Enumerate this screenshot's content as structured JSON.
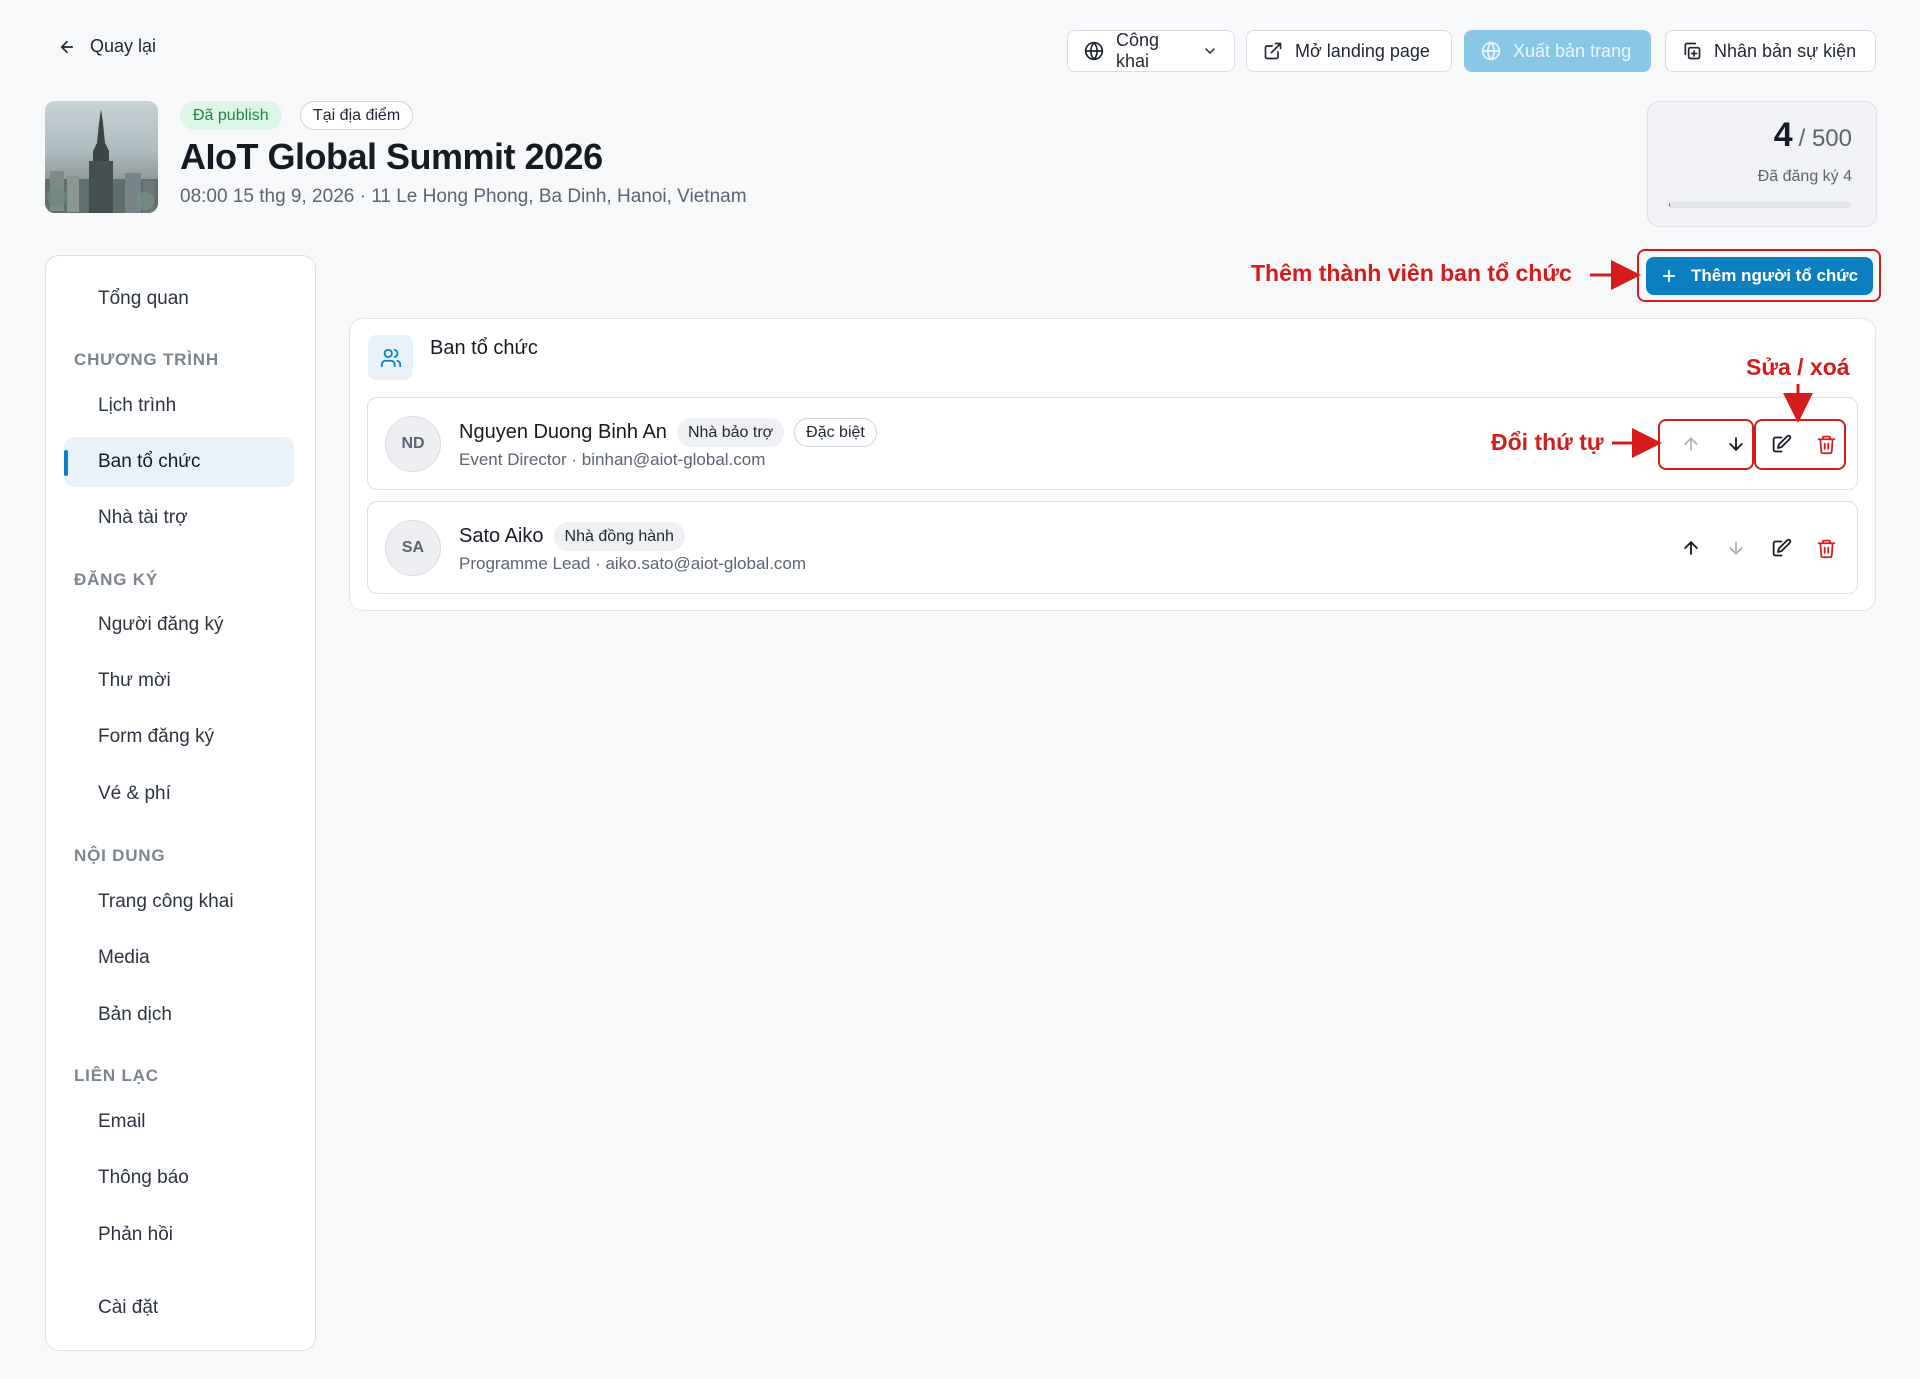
{
  "topbar": {
    "back_label": "Quay lại",
    "visibility_label": "Công khai",
    "open_landing_label": "Mở landing page",
    "publish_label": "Xuất bản trang",
    "duplicate_label": "Nhân bản sự kiện"
  },
  "event": {
    "status_badge": "Đã publish",
    "type_badge": "Tại địa điểm",
    "title": "AIoT Global Summit 2026",
    "subtitle": "08:00 15 thg 9, 2026 · 11 Le Hong Phong, Ba Dinh, Hanoi, Vietnam"
  },
  "capacity": {
    "registered": "4",
    "of_total": "/ 500",
    "label": "Đã đăng ký 4",
    "progress_fraction": 0.008
  },
  "sidebar": {
    "overview": "Tổng quan",
    "section_program": "CHƯƠNG TRÌNH",
    "schedule": "Lịch trình",
    "organizers": "Ban tổ chức",
    "sponsors": "Nhà tài trợ",
    "section_registration": "ĐĂNG KÝ",
    "registrants": "Người đăng ký",
    "invitations": "Thư mời",
    "reg_form": "Form đăng ký",
    "tickets": "Vé & phí",
    "section_content": "NỘI DUNG",
    "public_page": "Trang công khai",
    "media": "Media",
    "translations": "Bản dịch",
    "section_contact": "LIÊN LẠC",
    "email": "Email",
    "notifications": "Thông báo",
    "feedback": "Phản hồi",
    "settings": "Cài đặt"
  },
  "actions": {
    "add_organizer_label": "Thêm người tổ chức"
  },
  "panel": {
    "title": "Ban tổ chức",
    "organizers": [
      {
        "initials": "ND",
        "name": "Nguyen Duong Binh An",
        "tags": [
          "Nhà bảo trợ",
          "Đặc biệt"
        ],
        "meta": "Event Director · binhan@aiot-global.com"
      },
      {
        "initials": "SA",
        "name": "Sato Aiko",
        "tags": [
          "Nhà đồng hành"
        ],
        "meta": "Programme Lead · aiko.sato@aiot-global.com"
      }
    ]
  },
  "annotations": {
    "add_member": "Thêm thành viên ban tổ chức",
    "edit_delete": "Sửa / xoá",
    "reorder": "Đổi thứ tự"
  },
  "colors": {
    "primary": "#0b7fc0",
    "danger": "#d41c1c",
    "published_bg": "#ddf5e6",
    "published_text": "#188a43",
    "annotation": "#d41c1c"
  }
}
